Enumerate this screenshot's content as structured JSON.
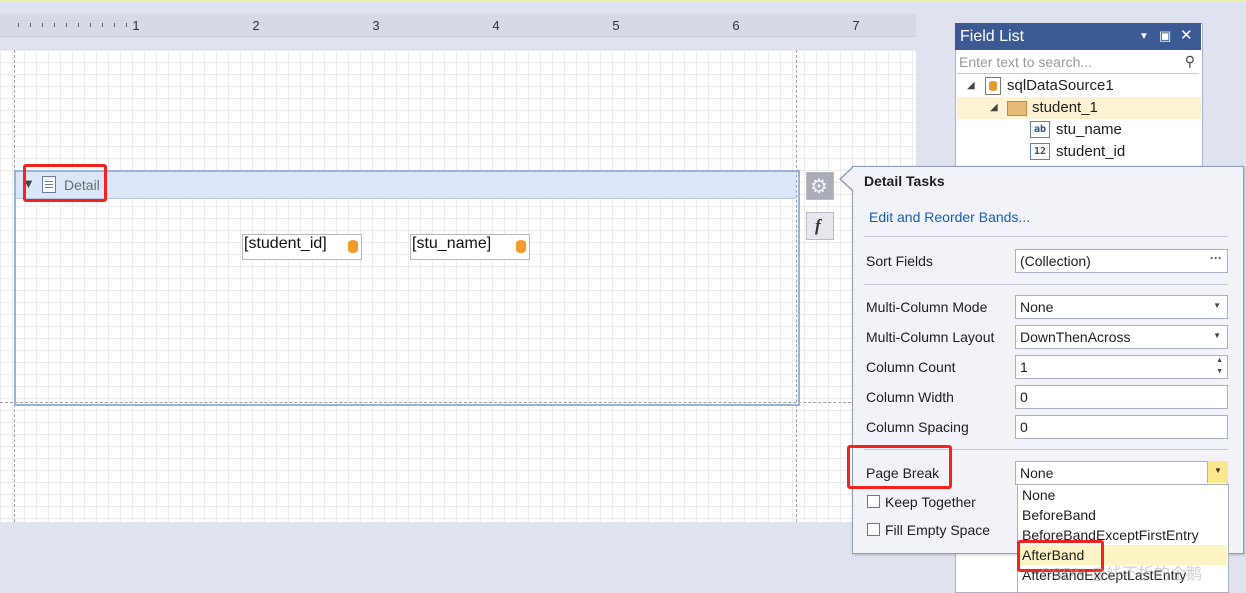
{
  "ruler": {
    "numbers": [
      "1",
      "2",
      "3",
      "4",
      "5",
      "6",
      "7"
    ]
  },
  "band": {
    "label": "Detail",
    "fields": [
      "[student_id]",
      "[stu_name]"
    ]
  },
  "side_buttons": {
    "fx_glyph": "f"
  },
  "field_list": {
    "title": "Field List",
    "search_placeholder": "Enter text to search...",
    "tree": [
      {
        "label": "sqlDataSource1",
        "icon": "database-icon"
      },
      {
        "label": "student_1",
        "icon": "table-icon"
      },
      {
        "label": "stu_name",
        "icon": "text-field-icon",
        "badge": "ab"
      },
      {
        "label": "student_id",
        "icon": "number-field-icon",
        "badge": "12"
      }
    ]
  },
  "tasks": {
    "title": "Detail Tasks",
    "edit_link": "Edit and Reorder Bands...",
    "sort_fields": {
      "label": "Sort Fields",
      "value": "(Collection)",
      "button": "···"
    },
    "multi_column_mode": {
      "label": "Multi-Column Mode",
      "value": "None"
    },
    "multi_column_layout": {
      "label": "Multi-Column Layout",
      "value": "DownThenAcross"
    },
    "column_count": {
      "label": "Column Count",
      "value": "1"
    },
    "column_width": {
      "label": "Column Width",
      "value": "0"
    },
    "column_spacing": {
      "label": "Column Spacing",
      "value": "0"
    },
    "page_break": {
      "label": "Page Break",
      "value": "None"
    },
    "keep_together": {
      "label": "Keep Together",
      "checked": false
    },
    "fill_empty_space": {
      "label": "Fill Empty Space",
      "checked": false
    }
  },
  "page_break_options": [
    "None",
    "BeforeBand",
    "BeforeBandExceptFirstEntry",
    "AfterBand",
    "AfterBandExceptLastEntry"
  ],
  "highlighted_option": "AfterBand",
  "watermark": "CSDN @线不折的企鹅",
  "colors": {
    "accent": "#3b5a94",
    "highlight_red": "#f5221d",
    "link": "#1a5fb4"
  }
}
